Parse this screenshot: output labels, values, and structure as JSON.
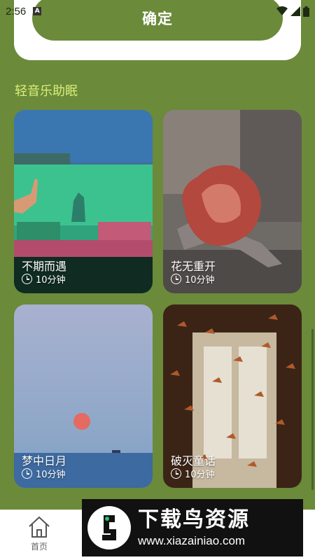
{
  "status_bar": {
    "time": "2:56",
    "notification_icon": "A"
  },
  "confirm_button": {
    "label": "确定"
  },
  "section": {
    "title": "轻音乐助眠"
  },
  "cards": [
    {
      "title": "不期而遇",
      "duration": "10分钟"
    },
    {
      "title": "花无重开",
      "duration": "10分钟"
    },
    {
      "title": "梦中日月",
      "duration": "10分钟"
    },
    {
      "title": "破灭童话",
      "duration": "10分钟"
    }
  ],
  "bottom_nav": {
    "home_label": "首页"
  },
  "watermark": {
    "title": "下载鸟资源",
    "url": "www.xiazainiao.com"
  },
  "colors": {
    "background": "#6b8a3a",
    "accent_text": "#d9ef79"
  }
}
